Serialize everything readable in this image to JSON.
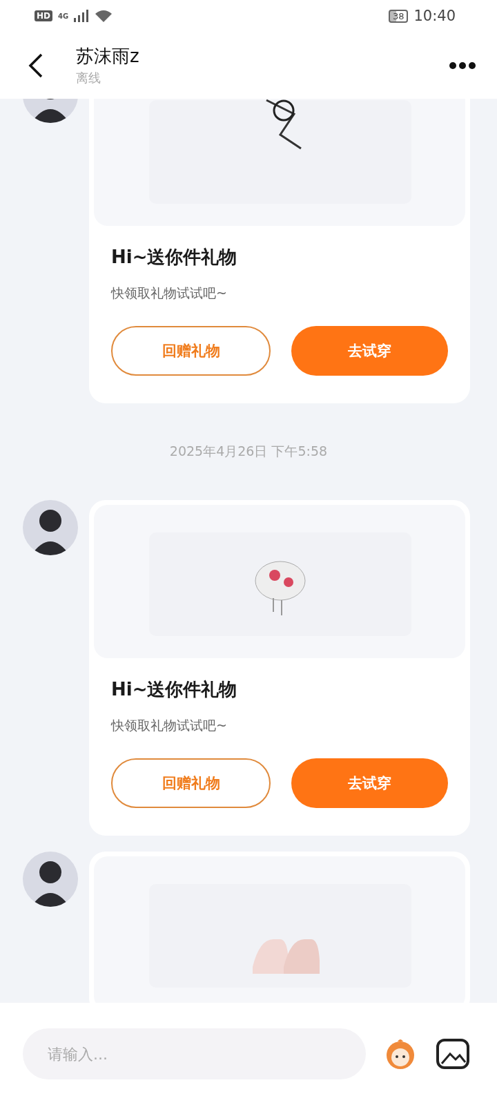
{
  "status_bar": {
    "badge": "HD",
    "network": "4G",
    "battery": "38",
    "time": "10:40"
  },
  "header": {
    "title": "苏沫雨z",
    "status": "离线"
  },
  "messages": [
    {
      "kind": "gift",
      "title": "Hi~送你件礼物",
      "subtitle": "快领取礼物试试吧~",
      "buttons": [
        "回赠礼物",
        "去试穿"
      ]
    },
    {
      "kind": "time",
      "text": "2025年4月26日 下午5:58"
    },
    {
      "kind": "gift",
      "title": "Hi~送你件礼物",
      "subtitle": "快领取礼物试试吧~",
      "buttons": [
        "回赠礼物",
        "去试穿"
      ]
    },
    {
      "kind": "gift"
    }
  ],
  "input": {
    "placeholder": "请输入..."
  }
}
